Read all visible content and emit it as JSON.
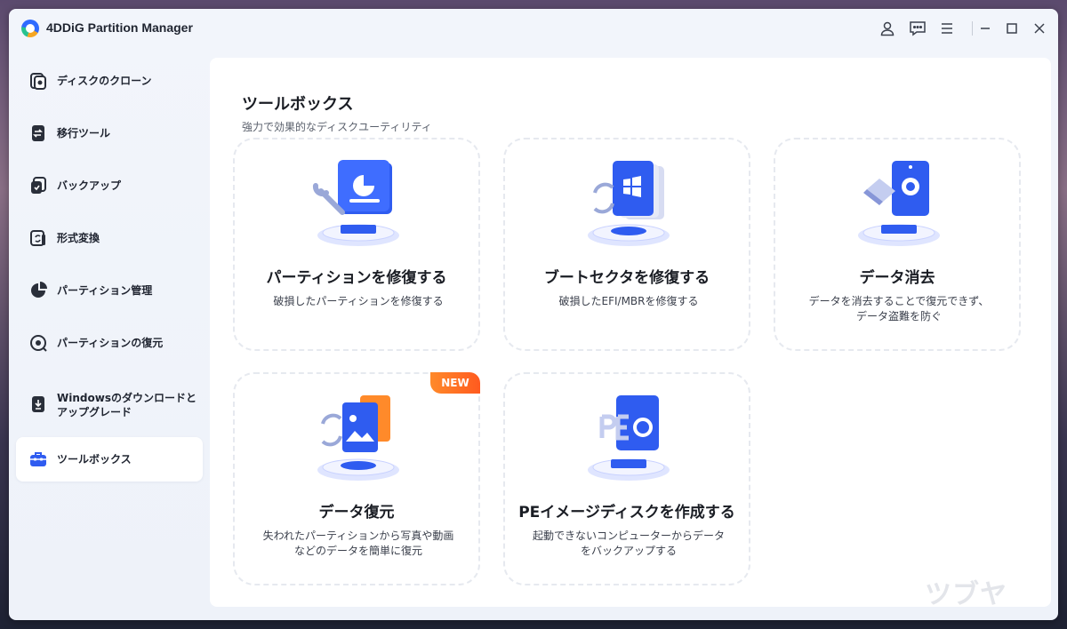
{
  "app": {
    "title": "4DDiG Partition Manager"
  },
  "sidebar": {
    "items": [
      {
        "label": "ディスクのクローン"
      },
      {
        "label": "移行ツール"
      },
      {
        "label": "バックアップ"
      },
      {
        "label": "形式変換"
      },
      {
        "label": "パーティション管理"
      },
      {
        "label": "パーティションの復元"
      },
      {
        "label": "Windowsのダウンロードとアップグレード"
      },
      {
        "label": "ツールボックス",
        "active": true
      }
    ]
  },
  "main": {
    "title": "ツールボックス",
    "subtitle": "強力で効果的なディスクユーティリティ",
    "cards": [
      {
        "title": "パーティションを修復する",
        "desc": "破損したパーティションを修復する"
      },
      {
        "title": "ブートセクタを修復する",
        "desc": "破損したEFI/MBRを修復する"
      },
      {
        "title": "データ消去",
        "desc": "データを消去することで復元できず、\nデータ盗難を防ぐ"
      },
      {
        "title": "データ復元",
        "desc": "失われたパーティションから写真や動画\nなどのデータを簡単に復元",
        "badge": "NEW"
      },
      {
        "title": "PEイメージディスクを作成する",
        "desc": "起動できないコンピューターからデータ\nをバックアップする"
      }
    ]
  },
  "watermark": "ツブヤク。",
  "colors": {
    "accent": "#2f5cf0",
    "badge": "#ff6a20",
    "window_bg": "#f0f3f9"
  }
}
